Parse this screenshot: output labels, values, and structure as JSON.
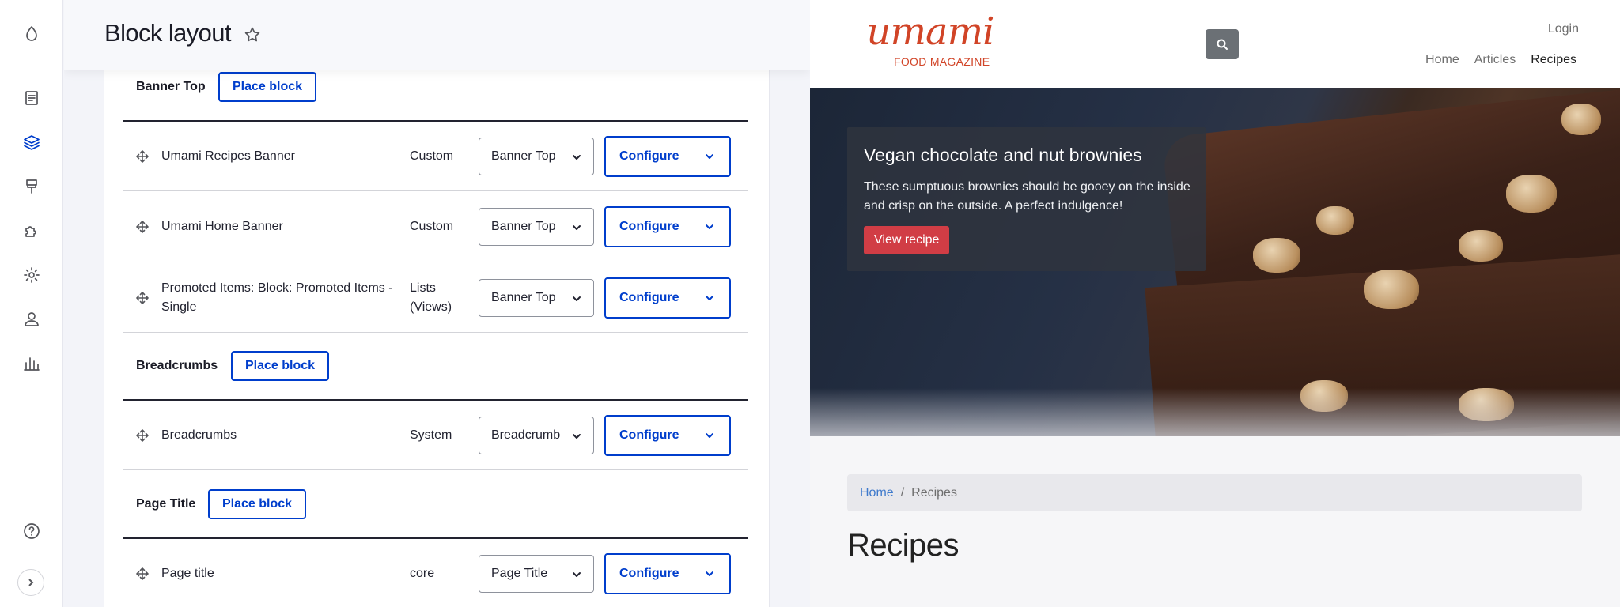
{
  "admin": {
    "page_title": "Block layout",
    "toolbar_icons": [
      "content-icon",
      "structure-icon",
      "appearance-icon",
      "extend-icon",
      "configuration-icon",
      "people-icon",
      "reports-icon",
      "help-icon"
    ]
  },
  "regions": [
    {
      "name": "Banner Top",
      "place_label": "Place block",
      "blocks": [
        {
          "title": "Umami Recipes Banner",
          "category": "Custom",
          "region": "Banner Top",
          "action": "Configure"
        },
        {
          "title": "Umami Home Banner",
          "category": "Custom",
          "region": "Banner Top",
          "action": "Configure"
        },
        {
          "title": "Promoted Items: Block: Promoted Items - Single",
          "category": "Lists (Views)",
          "region": "Banner Top",
          "action": "Configure"
        }
      ]
    },
    {
      "name": "Breadcrumbs",
      "place_label": "Place block",
      "blocks": [
        {
          "title": "Breadcrumbs",
          "category": "System",
          "region": "Breadcrumb",
          "action": "Configure"
        }
      ]
    },
    {
      "name": "Page Title",
      "place_label": "Place block",
      "blocks": [
        {
          "title": "Page title",
          "category": "core",
          "region": "Page Title",
          "action": "Configure"
        }
      ]
    }
  ],
  "site": {
    "logo_word": "umami",
    "logo_subtitle": "FOOD MAGAZINE",
    "login": "Login",
    "nav": [
      "Home",
      "Articles",
      "Recipes"
    ],
    "nav_current": "Recipes",
    "hero": {
      "title": "Vegan chocolate and nut brownies",
      "text": "These sumptuous brownies should be gooey on the inside and crisp on the outside. A perfect indulgence!",
      "button": "View recipe"
    },
    "breadcrumb": {
      "home": "Home",
      "separator": "/",
      "current": "Recipes"
    },
    "heading": "Recipes"
  },
  "colors": {
    "accent": "#003ecc",
    "brand": "#d14427",
    "hero_button": "#d13d45"
  }
}
